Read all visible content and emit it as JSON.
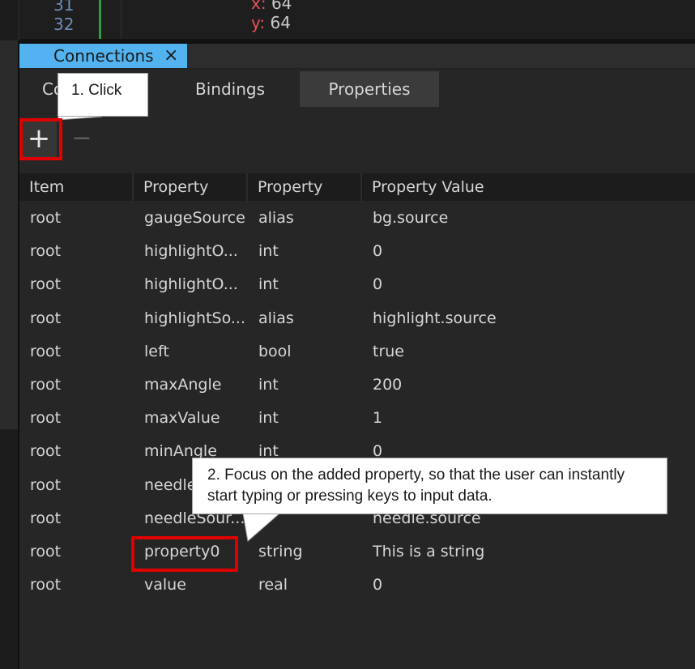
{
  "editor": {
    "line_numbers": [
      "31",
      "32"
    ],
    "code_lines": [
      {
        "key": "x:",
        "value": "64"
      },
      {
        "key": "y:",
        "value": "64"
      }
    ]
  },
  "panel": {
    "tab_label": "Connections",
    "close_glyph": "×"
  },
  "subtabs": [
    {
      "label": "Connections",
      "visible_label": "Co",
      "active": false
    },
    {
      "label": "Bindings",
      "active": false
    },
    {
      "label": "Properties",
      "active": true
    }
  ],
  "toolbar": {
    "add_glyph": "+",
    "remove_glyph": "−"
  },
  "table": {
    "headers": [
      "Item",
      "Property",
      "Property Type",
      "Property Value"
    ],
    "rows": [
      [
        "root",
        "gaugeSource",
        "alias",
        "bg.source"
      ],
      [
        "root",
        "highlightO...",
        "int",
        "0"
      ],
      [
        "root",
        "highlightO...",
        "int",
        "0"
      ],
      [
        "root",
        "highlightSo...",
        "alias",
        "highlight.source"
      ],
      [
        "root",
        "left",
        "bool",
        "true"
      ],
      [
        "root",
        "maxAngle",
        "int",
        "200"
      ],
      [
        "root",
        "maxValue",
        "int",
        "1"
      ],
      [
        "root",
        "minAngle",
        "int",
        "0"
      ],
      [
        "root",
        "needle",
        "",
        ""
      ],
      [
        "root",
        "needleSour...",
        "a",
        "needle.source"
      ],
      [
        "root",
        "property0",
        "string",
        "This is a string"
      ],
      [
        "root",
        "value",
        "real",
        "0"
      ]
    ]
  },
  "annotations": {
    "step1": "1. Click",
    "step2_line1": "2. Focus on the added property, so that the user can instantly",
    "step2_line2": "start typing or pressing keys to input data.",
    "highlight_color": "#e00000"
  }
}
